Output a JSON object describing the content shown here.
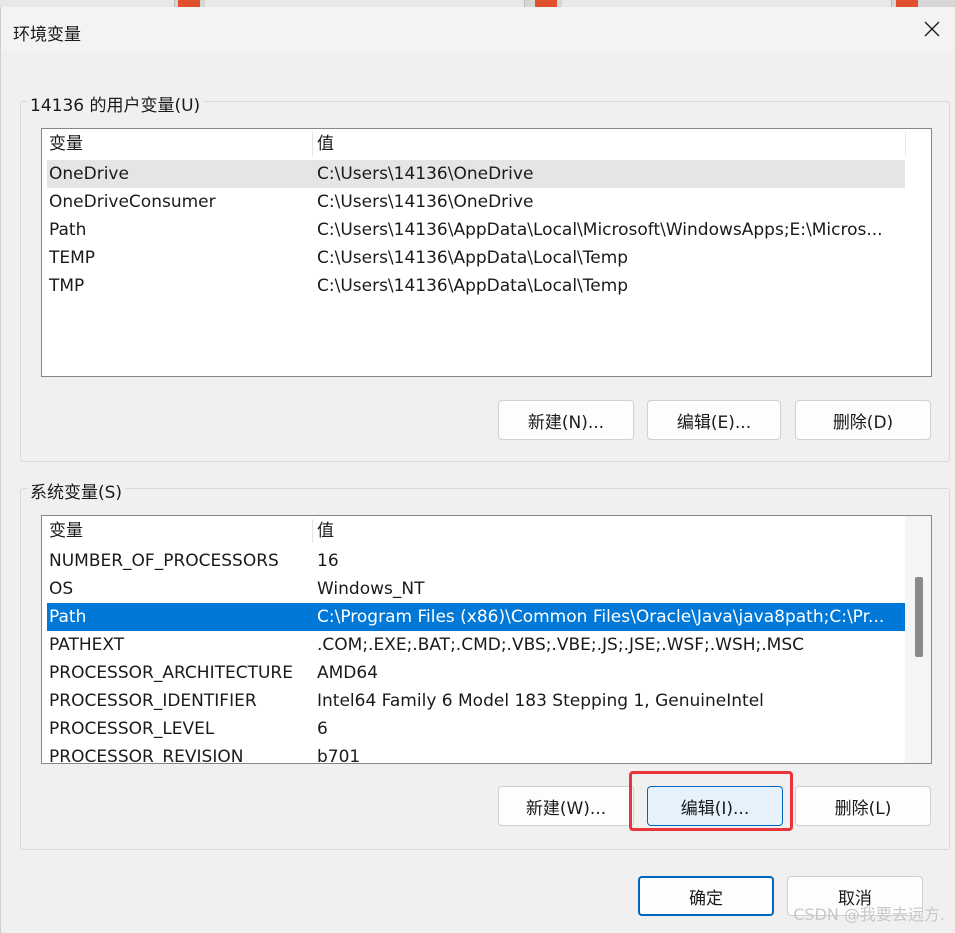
{
  "window": {
    "title": "环境变量"
  },
  "user_vars": {
    "label": "14136 的用户变量(U)",
    "header_name": "变量",
    "header_value": "值",
    "rows": [
      {
        "name": "OneDrive",
        "value": "C:\\Users\\14136\\OneDrive"
      },
      {
        "name": "OneDriveConsumer",
        "value": "C:\\Users\\14136\\OneDrive"
      },
      {
        "name": "Path",
        "value": "C:\\Users\\14136\\AppData\\Local\\Microsoft\\WindowsApps;E:\\Micros..."
      },
      {
        "name": "TEMP",
        "value": "C:\\Users\\14136\\AppData\\Local\\Temp"
      },
      {
        "name": "TMP",
        "value": "C:\\Users\\14136\\AppData\\Local\\Temp"
      }
    ],
    "new_button": "新建(N)...",
    "edit_button": "编辑(E)...",
    "delete_button": "删除(D)"
  },
  "system_vars": {
    "label": "系统变量(S)",
    "header_name": "变量",
    "header_value": "值",
    "rows": [
      {
        "name": "NUMBER_OF_PROCESSORS",
        "value": "16"
      },
      {
        "name": "OS",
        "value": "Windows_NT"
      },
      {
        "name": "Path",
        "value": "C:\\Program Files (x86)\\Common Files\\Oracle\\Java\\java8path;C:\\Pr..."
      },
      {
        "name": "PATHEXT",
        "value": ".COM;.EXE;.BAT;.CMD;.VBS;.VBE;.JS;.JSE;.WSF;.WSH;.MSC"
      },
      {
        "name": "PROCESSOR_ARCHITECTURE",
        "value": "AMD64"
      },
      {
        "name": "PROCESSOR_IDENTIFIER",
        "value": "Intel64 Family 6 Model 183 Stepping 1, GenuineIntel"
      },
      {
        "name": "PROCESSOR_LEVEL",
        "value": "6"
      },
      {
        "name": "PROCESSOR_REVISION",
        "value": "b701"
      }
    ],
    "selected_row": "Path",
    "new_button": "新建(W)...",
    "edit_button": "编辑(I)...",
    "delete_button": "删除(L)"
  },
  "footer": {
    "ok_button": "确定",
    "cancel_button": "取消"
  },
  "watermark": "CSDN @我要去远方.",
  "colors": {
    "selection": "#0078d7",
    "highlight_box": "#e8343a",
    "accent": "#0067c0"
  }
}
